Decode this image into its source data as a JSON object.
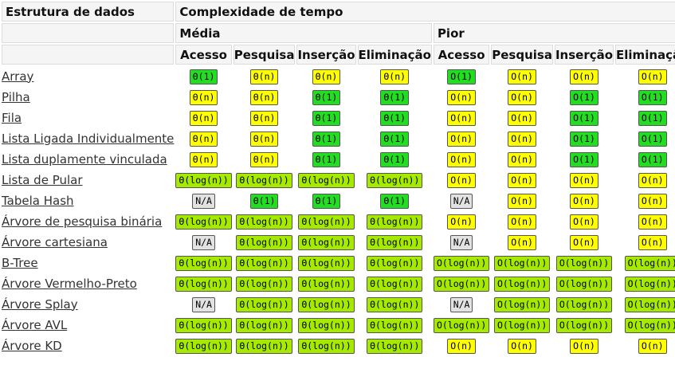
{
  "header": {
    "structure_label": "Estrutura de dados",
    "time_label": "Complexidade de tempo",
    "groups": [
      "Média",
      "Pior"
    ],
    "columns": [
      "Acesso",
      "Pesquisa",
      "Inserção",
      "Eliminação",
      "Acesso",
      "Pesquisa",
      "Inserção",
      "Eliminação"
    ]
  },
  "legend_colors": {
    "good": "#22dd22",
    "fair": "#a6ea00",
    "bad": "#ffff00",
    "na": "#e2e2e2"
  },
  "rows": [
    {
      "name": "Array",
      "cells": [
        [
          "Θ(1)",
          "good"
        ],
        [
          "Θ(n)",
          "bad"
        ],
        [
          "Θ(n)",
          "bad"
        ],
        [
          "Θ(n)",
          "bad"
        ],
        [
          "O(1)",
          "good"
        ],
        [
          "O(n)",
          "bad"
        ],
        [
          "O(n)",
          "bad"
        ],
        [
          "O(n)",
          "bad"
        ]
      ]
    },
    {
      "name": "Pilha",
      "cells": [
        [
          "Θ(n)",
          "bad"
        ],
        [
          "Θ(n)",
          "bad"
        ],
        [
          "Θ(1)",
          "good"
        ],
        [
          "Θ(1)",
          "good"
        ],
        [
          "O(n)",
          "bad"
        ],
        [
          "O(n)",
          "bad"
        ],
        [
          "O(1)",
          "good"
        ],
        [
          "O(1)",
          "good"
        ]
      ]
    },
    {
      "name": "Fila",
      "cells": [
        [
          "Θ(n)",
          "bad"
        ],
        [
          "Θ(n)",
          "bad"
        ],
        [
          "Θ(1)",
          "good"
        ],
        [
          "Θ(1)",
          "good"
        ],
        [
          "O(n)",
          "bad"
        ],
        [
          "O(n)",
          "bad"
        ],
        [
          "O(1)",
          "good"
        ],
        [
          "O(1)",
          "good"
        ]
      ]
    },
    {
      "name": "Lista Ligada Individualmente",
      "cells": [
        [
          "Θ(n)",
          "bad"
        ],
        [
          "Θ(n)",
          "bad"
        ],
        [
          "Θ(1)",
          "good"
        ],
        [
          "Θ(1)",
          "good"
        ],
        [
          "O(n)",
          "bad"
        ],
        [
          "O(n)",
          "bad"
        ],
        [
          "O(1)",
          "good"
        ],
        [
          "O(1)",
          "good"
        ]
      ]
    },
    {
      "name": "Lista duplamente vinculada",
      "cells": [
        [
          "Θ(n)",
          "bad"
        ],
        [
          "Θ(n)",
          "bad"
        ],
        [
          "Θ(1)",
          "good"
        ],
        [
          "Θ(1)",
          "good"
        ],
        [
          "O(n)",
          "bad"
        ],
        [
          "O(n)",
          "bad"
        ],
        [
          "O(1)",
          "good"
        ],
        [
          "O(1)",
          "good"
        ]
      ]
    },
    {
      "name": "Lista de Pular",
      "cells": [
        [
          "Θ(log(n))",
          "fair"
        ],
        [
          "Θ(log(n))",
          "fair"
        ],
        [
          "Θ(log(n))",
          "fair"
        ],
        [
          "Θ(log(n))",
          "fair"
        ],
        [
          "O(n)",
          "bad"
        ],
        [
          "O(n)",
          "bad"
        ],
        [
          "O(n)",
          "bad"
        ],
        [
          "O(n)",
          "bad"
        ]
      ]
    },
    {
      "name": "Tabela Hash",
      "cells": [
        [
          "N/A",
          "na"
        ],
        [
          "Θ(1)",
          "good"
        ],
        [
          "Θ(1)",
          "good"
        ],
        [
          "Θ(1)",
          "good"
        ],
        [
          "N/A",
          "na"
        ],
        [
          "O(n)",
          "bad"
        ],
        [
          "O(n)",
          "bad"
        ],
        [
          "O(n)",
          "bad"
        ]
      ]
    },
    {
      "name": "Árvore de pesquisa binária",
      "cells": [
        [
          "Θ(log(n))",
          "fair"
        ],
        [
          "Θ(log(n))",
          "fair"
        ],
        [
          "Θ(log(n))",
          "fair"
        ],
        [
          "Θ(log(n))",
          "fair"
        ],
        [
          "O(n)",
          "bad"
        ],
        [
          "O(n)",
          "bad"
        ],
        [
          "O(n)",
          "bad"
        ],
        [
          "O(n)",
          "bad"
        ]
      ]
    },
    {
      "name": "Árvore cartesiana",
      "cells": [
        [
          "N/A",
          "na"
        ],
        [
          "Θ(log(n))",
          "fair"
        ],
        [
          "Θ(log(n))",
          "fair"
        ],
        [
          "Θ(log(n))",
          "fair"
        ],
        [
          "N/A",
          "na"
        ],
        [
          "O(n)",
          "bad"
        ],
        [
          "O(n)",
          "bad"
        ],
        [
          "O(n)",
          "bad"
        ]
      ]
    },
    {
      "name": "B-Tree",
      "cells": [
        [
          "Θ(log(n))",
          "fair"
        ],
        [
          "Θ(log(n))",
          "fair"
        ],
        [
          "Θ(log(n))",
          "fair"
        ],
        [
          "Θ(log(n))",
          "fair"
        ],
        [
          "O(log(n))",
          "fair"
        ],
        [
          "O(log(n))",
          "fair"
        ],
        [
          "O(log(n))",
          "fair"
        ],
        [
          "O(log(n))",
          "fair"
        ]
      ]
    },
    {
      "name": "Árvore Vermelho-Preto",
      "cells": [
        [
          "Θ(log(n))",
          "fair"
        ],
        [
          "Θ(log(n))",
          "fair"
        ],
        [
          "Θ(log(n))",
          "fair"
        ],
        [
          "Θ(log(n))",
          "fair"
        ],
        [
          "O(log(n))",
          "fair"
        ],
        [
          "O(log(n))",
          "fair"
        ],
        [
          "O(log(n))",
          "fair"
        ],
        [
          "O(log(n))",
          "fair"
        ]
      ]
    },
    {
      "name": "Árvore Splay",
      "cells": [
        [
          "N/A",
          "na"
        ],
        [
          "Θ(log(n))",
          "fair"
        ],
        [
          "Θ(log(n))",
          "fair"
        ],
        [
          "Θ(log(n))",
          "fair"
        ],
        [
          "N/A",
          "na"
        ],
        [
          "O(log(n))",
          "fair"
        ],
        [
          "O(log(n))",
          "fair"
        ],
        [
          "O(log(n))",
          "fair"
        ]
      ]
    },
    {
      "name": "Árvore AVL",
      "cells": [
        [
          "Θ(log(n))",
          "fair"
        ],
        [
          "Θ(log(n))",
          "fair"
        ],
        [
          "Θ(log(n))",
          "fair"
        ],
        [
          "Θ(log(n))",
          "fair"
        ],
        [
          "O(log(n))",
          "fair"
        ],
        [
          "O(log(n))",
          "fair"
        ],
        [
          "O(log(n))",
          "fair"
        ],
        [
          "O(log(n))",
          "fair"
        ]
      ]
    },
    {
      "name": "Árvore KD",
      "cells": [
        [
          "Θ(log(n))",
          "fair"
        ],
        [
          "Θ(log(n))",
          "fair"
        ],
        [
          "Θ(log(n))",
          "fair"
        ],
        [
          "Θ(log(n))",
          "fair"
        ],
        [
          "O(n)",
          "bad"
        ],
        [
          "O(n)",
          "bad"
        ],
        [
          "O(n)",
          "bad"
        ],
        [
          "O(n)",
          "bad"
        ]
      ]
    }
  ]
}
